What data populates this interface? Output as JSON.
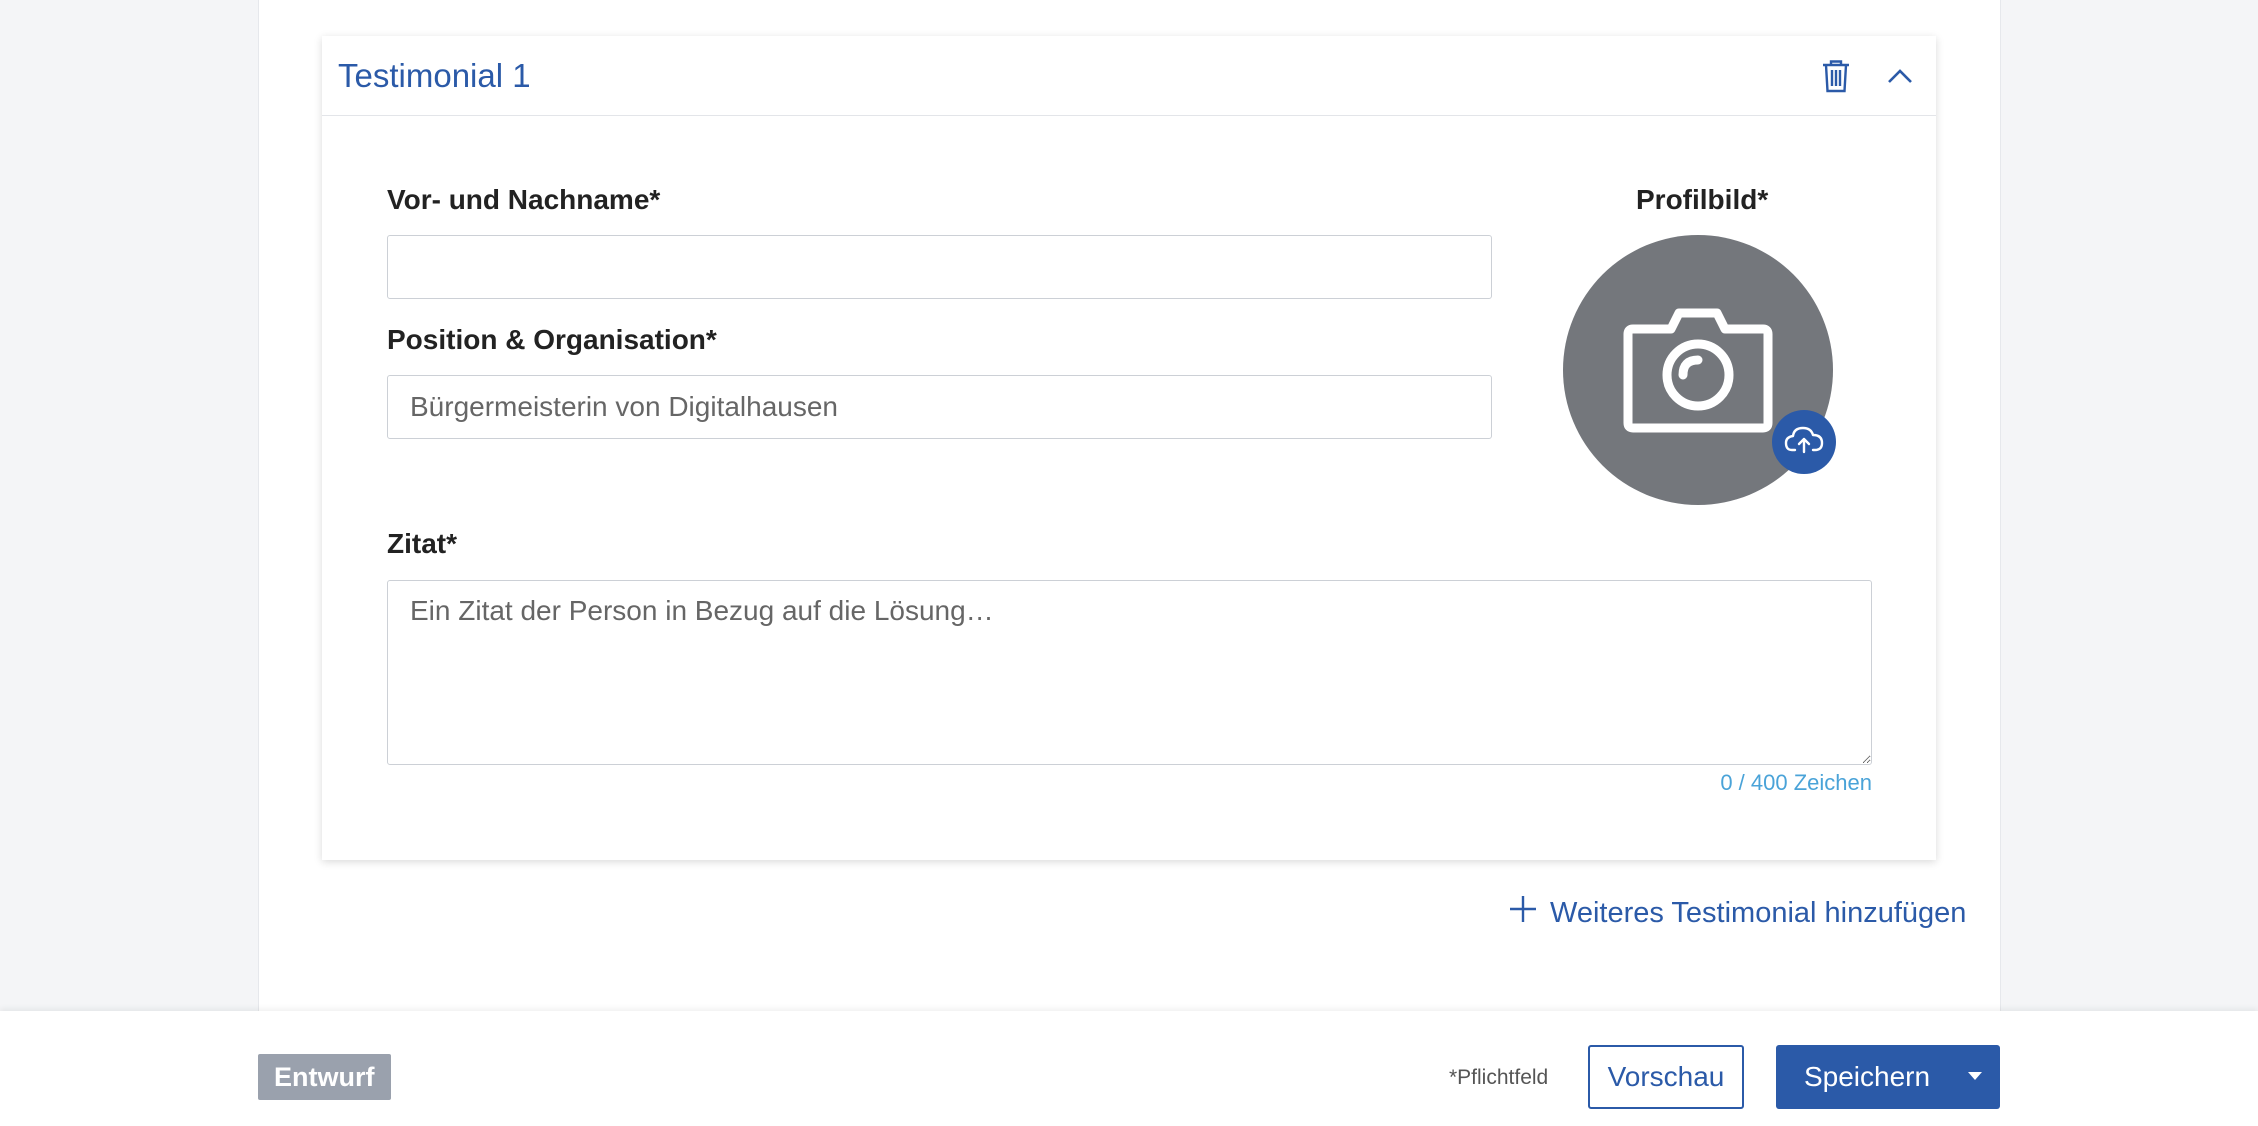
{
  "testimonial": {
    "title": "Testimonial 1",
    "name_label": "Vor- und Nachname*",
    "name_value": "",
    "position_label": "Position & Organisation*",
    "position_placeholder": "Bürgermeisterin von Digitalhausen",
    "profile_label": "Profilbild*",
    "quote_label": "Zitat*",
    "quote_placeholder": "Ein Zitat der Person in Bezug auf die Lösung…",
    "char_counter": "0 / 400 Zeichen"
  },
  "add_link_label": "Weiteres Testimonial hinzufügen",
  "footer": {
    "status_badge": "Entwurf",
    "required_note": "*Pflichtfeld",
    "preview_label": "Vorschau",
    "save_label": "Speichern"
  },
  "colors": {
    "accent": "#2b5aa8",
    "counter": "#4aa3d8",
    "avatar_bg": "#74777c",
    "badge_bg": "#9aa1ad"
  },
  "icons": [
    "trash-icon",
    "chevron-up-icon",
    "camera-icon",
    "cloud-upload-icon",
    "plus-icon",
    "caret-down-icon"
  ]
}
